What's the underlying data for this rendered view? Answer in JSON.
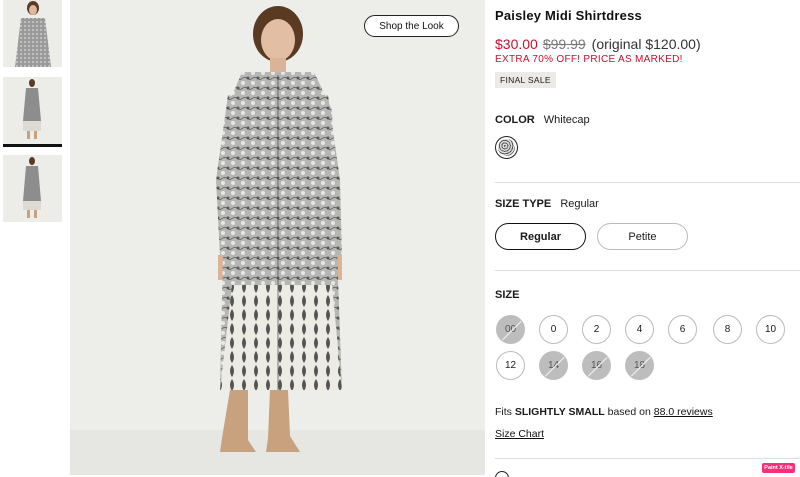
{
  "product": {
    "title": "Paisley Midi Shirtdress",
    "price_sale": "$30.00",
    "price_was": "$99.99",
    "price_original": "(original $120.00)",
    "promo": "EXTRA 70% OFF! PRICE AS MARKED!",
    "final_sale": "FINAL SALE"
  },
  "media": {
    "shop_the_look": "Shop the Look"
  },
  "color": {
    "label": "COLOR",
    "value": "Whitecap"
  },
  "size_type": {
    "label": "SIZE TYPE",
    "value": "Regular",
    "options": [
      "Regular",
      "Petite"
    ]
  },
  "size": {
    "label": "SIZE",
    "options": [
      {
        "label": "00",
        "available": false
      },
      {
        "label": "0",
        "available": true
      },
      {
        "label": "2",
        "available": true
      },
      {
        "label": "4",
        "available": true
      },
      {
        "label": "6",
        "available": true
      },
      {
        "label": "8",
        "available": true
      },
      {
        "label": "10",
        "available": true
      },
      {
        "label": "12",
        "available": true
      },
      {
        "label": "14",
        "available": false
      },
      {
        "label": "16",
        "available": false
      },
      {
        "label": "18",
        "available": false
      }
    ]
  },
  "fit": {
    "prefix": "Fits",
    "rating": "SLIGHTLY SMALL",
    "middle": "based on",
    "reviews": "88.0 reviews",
    "size_chart": "Size Chart"
  },
  "badge": {
    "text": "Paint X-tile"
  }
}
